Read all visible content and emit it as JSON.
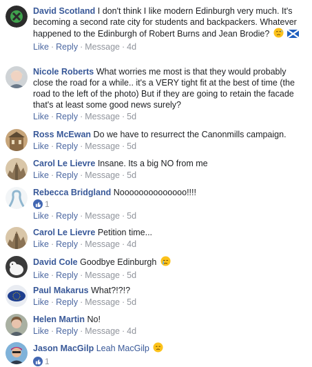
{
  "actions": {
    "like": "Like",
    "reply": "Reply",
    "message": "Message",
    "separator": "·"
  },
  "comments": [
    {
      "author": "David Scotland",
      "text": "I don't think I like modern Edinburgh very much. It's becoming a second rate city for students and backpackers. Whatever happened to the Edinburgh of Robert Burns and Jean Brodie?",
      "emojis": [
        "disappointed-relieved-emoji",
        "scotland-flag-icon"
      ],
      "time": "4d"
    },
    {
      "author": "Nicole Roberts",
      "text": "What worries me most is that they would probably close the road for a while.. it's a VERY tight fit at the best of time (the road to the left of the photo) But if they are going to retain the facade that's at least some good news surely?",
      "time": "5d"
    },
    {
      "author": "Ross McEwan",
      "text": "Do we have to resurrect the Canonmills campaign.",
      "time": "5d"
    },
    {
      "author": "Carol Le Lievre",
      "text": "Insane. Its a big NO from me",
      "time": "5d"
    },
    {
      "author": "Rebecca Bridgland",
      "text": "Noooooooooooooo!!!!",
      "reaction_count": "1",
      "time": "5d"
    },
    {
      "author": "Carol Le Lievre",
      "text": "Petition time...",
      "time": "4d"
    },
    {
      "author": "David Cole",
      "text": "Goodbye Edinburgh",
      "emojis": [
        "crying-face-emoji"
      ],
      "time": "5d"
    },
    {
      "author": "Paul Makarus",
      "text": "What?!?!?",
      "time": "5d"
    },
    {
      "author": "Helen Martin",
      "text": "No!",
      "time": "4d"
    },
    {
      "author": "Jason MacGilp",
      "text": "Leah MacGilp",
      "emojis": [
        "disappointed-face-emoji"
      ],
      "reaction_count": "1",
      "time": ""
    }
  ],
  "colors": {
    "author": "#385898",
    "action_link": "#4b67a1",
    "muted": "#90949c",
    "like_badge": "#4267b2"
  }
}
